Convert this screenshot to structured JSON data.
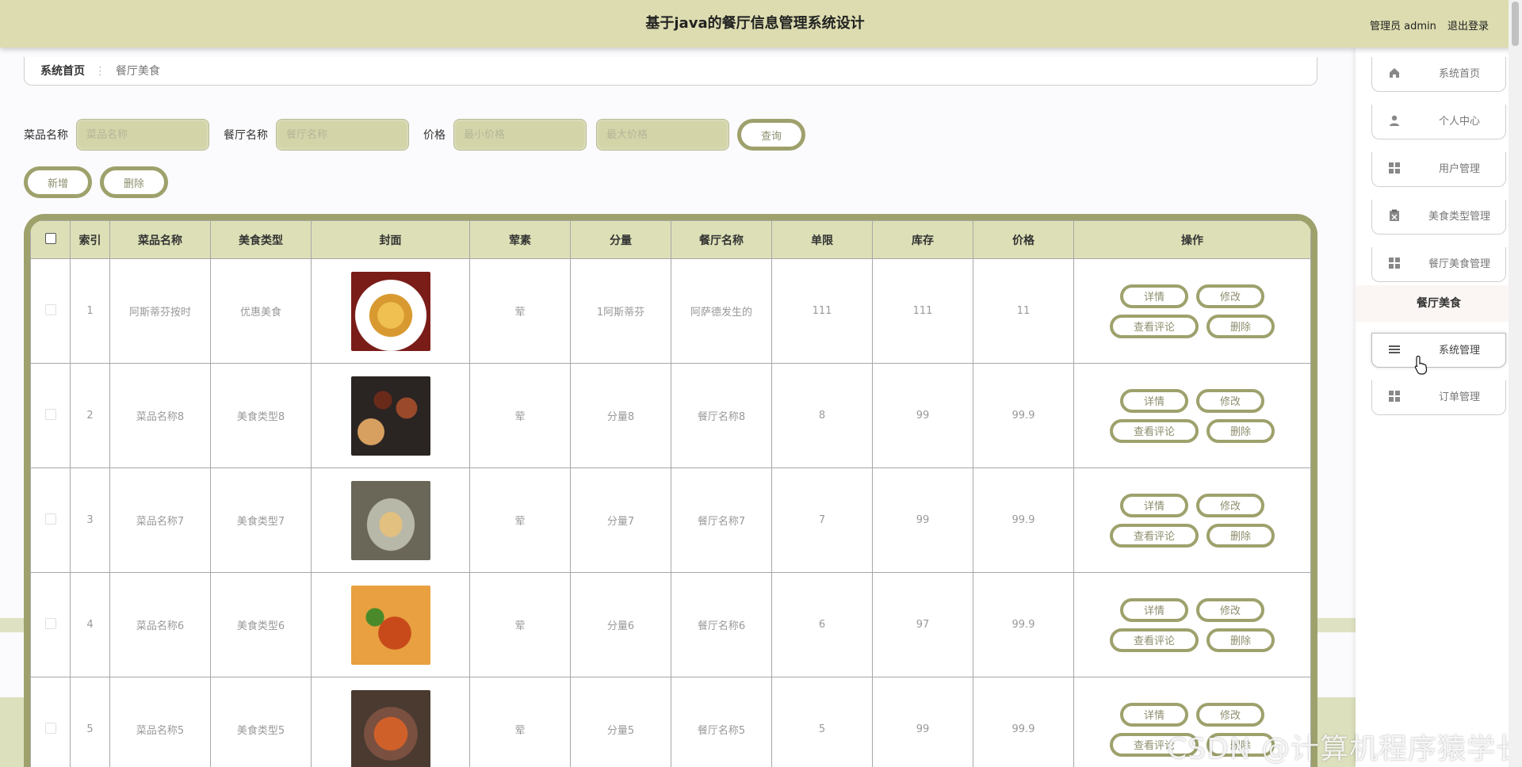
{
  "header": {
    "title": "基于java的餐厅信息管理系统设计",
    "user": "管理员 admin",
    "logout": "退出登录"
  },
  "breadcrumb": {
    "home": "系统首页",
    "separator": "⋮",
    "current": "餐厅美食"
  },
  "search": {
    "fields": [
      {
        "label": "菜品名称",
        "placeholder": "菜品名称"
      },
      {
        "label": "餐厅名称",
        "placeholder": "餐厅名称"
      },
      {
        "label": "价格",
        "placeholder_min": "最小价格",
        "placeholder_max": "最大价格"
      }
    ],
    "query_button": "查询"
  },
  "actions": {
    "add": "新增",
    "delete": "删除"
  },
  "table": {
    "columns": [
      "索引",
      "菜品名称",
      "美食类型",
      "封面",
      "荤素",
      "分量",
      "餐厅名称",
      "单限",
      "库存",
      "价格",
      "操作"
    ],
    "rows": [
      {
        "index": "1",
        "name": "阿斯蒂芬按时",
        "type": "优惠美食",
        "cover": "food-photo-1",
        "meat": "荤",
        "portion": "1阿斯蒂芬",
        "restaurant": "阿萨德发生的",
        "limit": "111",
        "stock": "111",
        "price": "11"
      },
      {
        "index": "2",
        "name": "菜品名称8",
        "type": "美食类型8",
        "cover": "food-photo-2",
        "meat": "荤",
        "portion": "分量8",
        "restaurant": "餐厅名称8",
        "limit": "8",
        "stock": "99",
        "price": "99.9"
      },
      {
        "index": "3",
        "name": "菜品名称7",
        "type": "美食类型7",
        "cover": "food-photo-3",
        "meat": "荤",
        "portion": "分量7",
        "restaurant": "餐厅名称7",
        "limit": "7",
        "stock": "99",
        "price": "99.9"
      },
      {
        "index": "4",
        "name": "菜品名称6",
        "type": "美食类型6",
        "cover": "food-photo-4",
        "meat": "荤",
        "portion": "分量6",
        "restaurant": "餐厅名称6",
        "limit": "6",
        "stock": "97",
        "price": "99.9"
      },
      {
        "index": "5",
        "name": "菜品名称5",
        "type": "美食类型5",
        "cover": "food-photo-5",
        "meat": "荤",
        "portion": "分量5",
        "restaurant": "餐厅名称5",
        "limit": "5",
        "stock": "99",
        "price": "99.9"
      }
    ],
    "row_buttons": {
      "detail": "详情",
      "edit": "修改",
      "comments": "查看评论",
      "delete": "删除"
    }
  },
  "sidebar": {
    "items": [
      {
        "label": "系统首页",
        "icon": "home-icon"
      },
      {
        "label": "个人中心",
        "icon": "user-icon"
      },
      {
        "label": "用户管理",
        "icon": "grid-icon"
      },
      {
        "label": "美食类型管理",
        "icon": "clipboard-icon"
      },
      {
        "label": "餐厅美食管理",
        "icon": "grid-icon"
      },
      {
        "label": "系统管理",
        "icon": "list-icon"
      },
      {
        "label": "订单管理",
        "icon": "grid-icon"
      }
    ],
    "subitem": "餐厅美食"
  },
  "watermark": "CSDN @计算机程序猿学长",
  "colors": {
    "header_bg": "#dcdcb0",
    "accent": "#9ea16c",
    "input_bg": "#d3d5a9",
    "table_head_bg": "#dde0b6"
  }
}
